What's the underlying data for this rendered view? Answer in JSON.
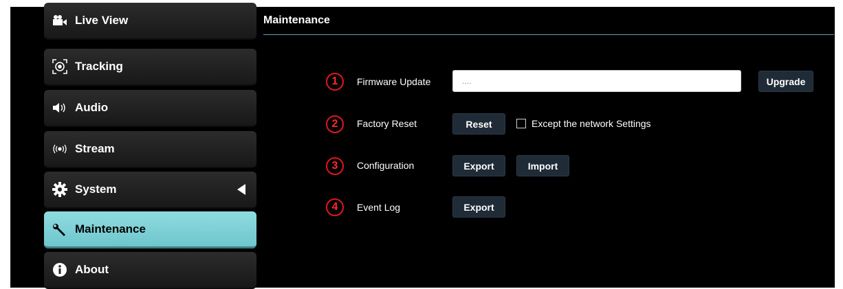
{
  "sidebar": {
    "items": [
      {
        "label": "Live View",
        "icon": "video-camera-icon"
      },
      {
        "label": "Tracking",
        "icon": "tracking-icon"
      },
      {
        "label": "Audio",
        "icon": "speaker-icon"
      },
      {
        "label": "Stream",
        "icon": "broadcast-icon"
      },
      {
        "label": "System",
        "icon": "gear-icon"
      },
      {
        "label": "Maintenance",
        "icon": "wrench-icon"
      },
      {
        "label": "About",
        "icon": "info-icon"
      }
    ],
    "active": "Maintenance"
  },
  "main": {
    "title": "Maintenance",
    "rows": [
      {
        "number": "1",
        "label": "Firmware Update",
        "input_value": "....",
        "button": "Upgrade"
      },
      {
        "number": "2",
        "label": "Factory Reset",
        "button": "Reset",
        "checkbox_label": "Except the network Settings"
      },
      {
        "number": "3",
        "label": "Configuration",
        "button": "Export",
        "button2": "Import"
      },
      {
        "number": "4",
        "label": "Event Log",
        "button": "Export"
      }
    ]
  },
  "colors": {
    "accent": "#7fd3d8",
    "callout_red": "#e01818",
    "background": "#000000",
    "button": "#1f2b36"
  }
}
